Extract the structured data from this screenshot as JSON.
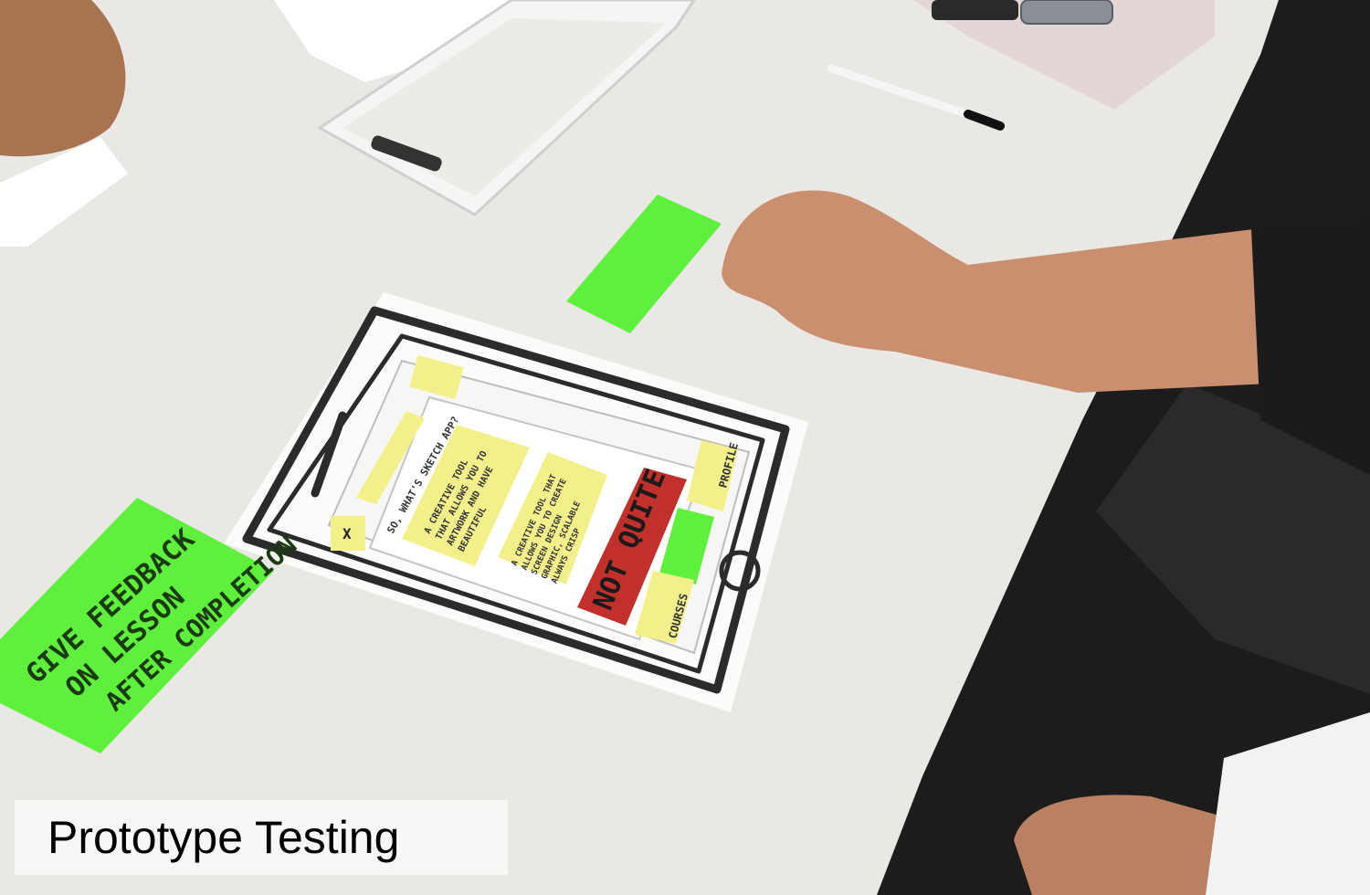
{
  "caption": "Prototype Testing",
  "sticky_notes": {
    "big_green": [
      "GIVE FEEDBACK",
      "ON LESSON",
      "AFTER COMPLETION"
    ],
    "not_quite": "NOT QUITE",
    "card_a": [
      "A CREATIVE TOOL",
      "THAT ALLOWS YOU TO",
      "ARTWORK AND HAVE",
      "BEAUTIFUL"
    ],
    "card_b": [
      "A CREATIVE TOOL THAT",
      "ALLOWS YOU TO CREATE",
      "SCREEN DESIGN",
      "GRAPHIC, SCALABLE",
      "ALWAYS CRISP"
    ],
    "question": "SO, WHAT'S SKETCH APP?",
    "nav_profile": "PROFILE",
    "nav_courses": "COURSES",
    "x_button": "X"
  },
  "colors": {
    "table": "#e9e8e4",
    "floor": "#1c1c1c",
    "green_note": "#5ef03c",
    "yellow_note": "#f3f08c",
    "red_note": "#c2302b",
    "skin": "#c98f6e"
  }
}
